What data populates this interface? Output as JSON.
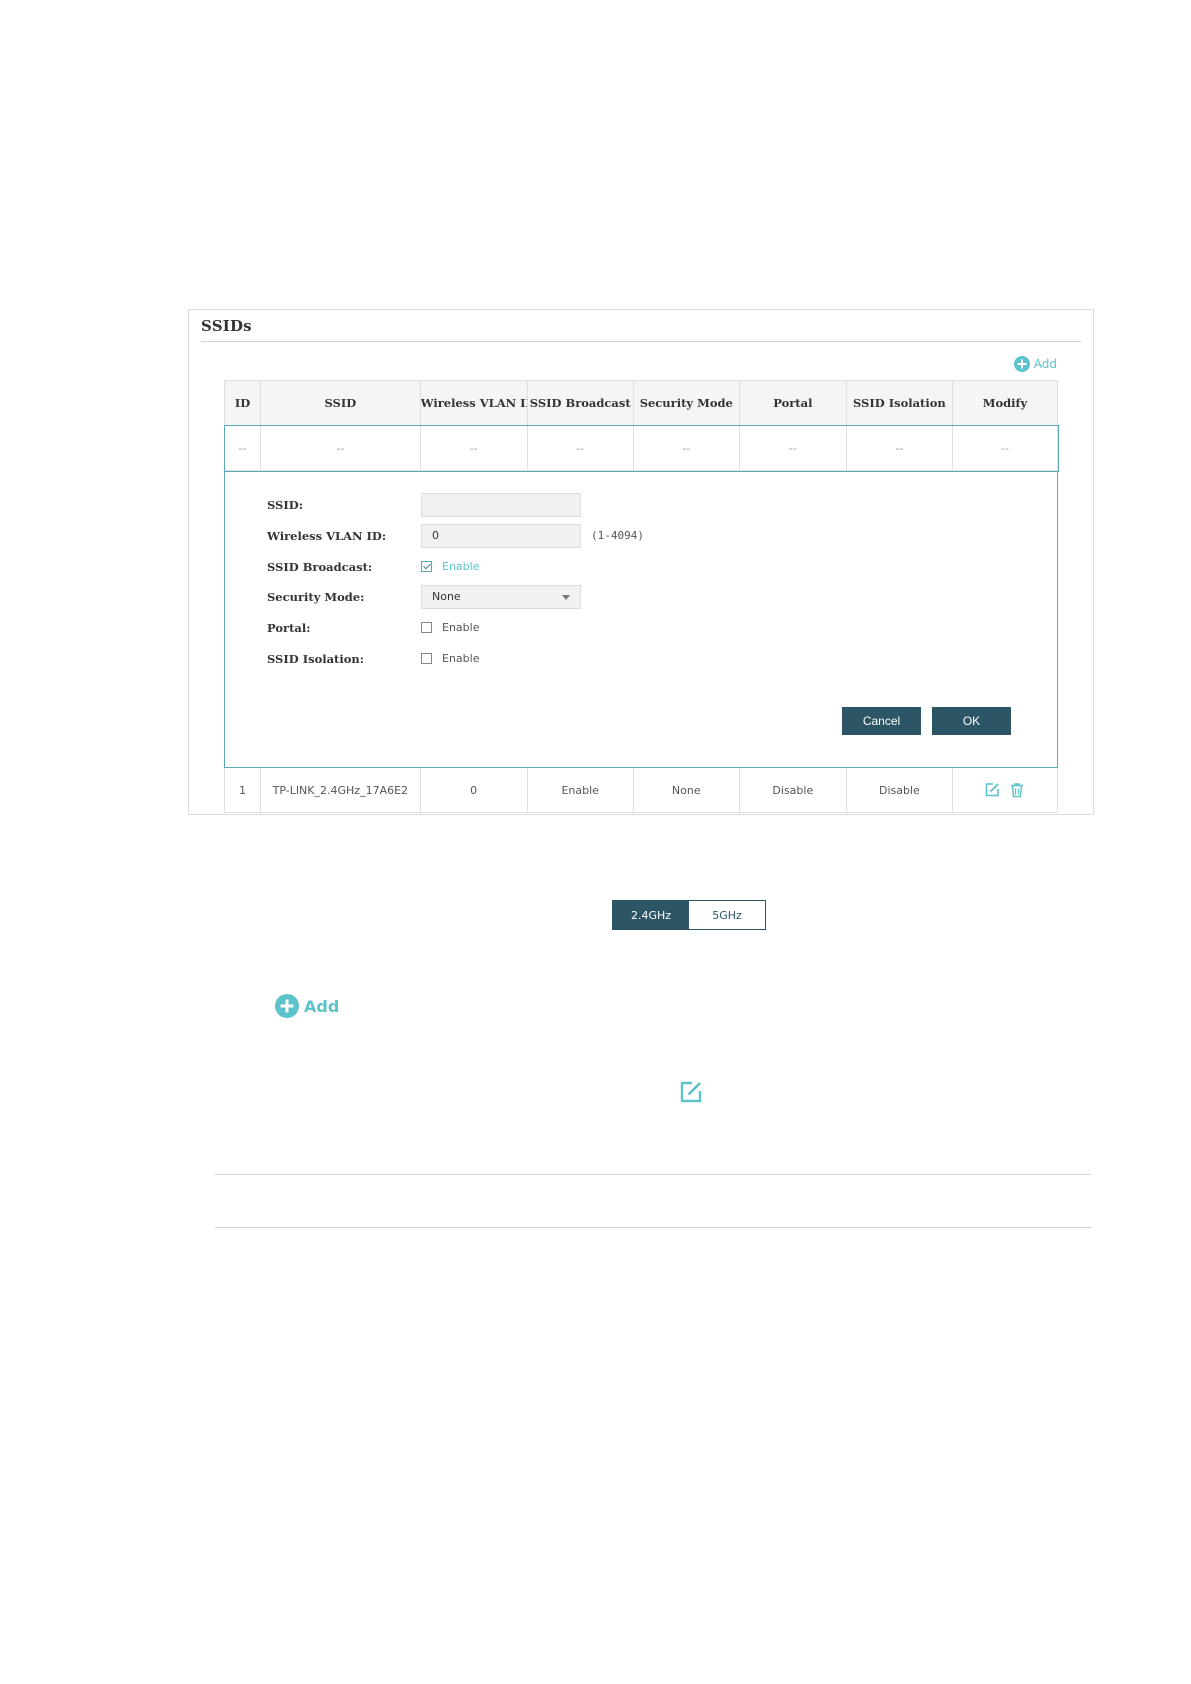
{
  "panel": {
    "title": "SSIDs",
    "add_label": "Add",
    "columns": [
      "ID",
      "SSID",
      "Wireless VLAN ID",
      "SSID Broadcast",
      "Security Mode",
      "Portal",
      "SSID Isolation",
      "Modify"
    ],
    "placeholder_row": [
      "--",
      "--",
      "--",
      "--",
      "--",
      "--",
      "--",
      "--"
    ],
    "form": {
      "ssid_label": "SSID:",
      "ssid_value": "",
      "vlan_label": "Wireless VLAN ID:",
      "vlan_value": "0",
      "vlan_hint": "(1-4094)",
      "broadcast_label": "SSID Broadcast:",
      "broadcast_option": "Enable",
      "security_label": "Security Mode:",
      "security_value": "None",
      "portal_label": "Portal:",
      "portal_option": "Enable",
      "isolation_label": "SSID Isolation:",
      "isolation_option": "Enable",
      "cancel_label": "Cancel",
      "ok_label": "OK"
    },
    "rows": [
      {
        "id": "1",
        "ssid": "TP-LINK_2.4GHz_17A6E2",
        "vlan": "0",
        "broadcast": "Enable",
        "security": "None",
        "portal": "Disable",
        "isolation": "Disable"
      }
    ]
  },
  "band": {
    "option_1": "2.4GHz",
    "option_2": "5GHz"
  },
  "add_button": {
    "label": "Add"
  },
  "colors": {
    "accent": "#5bc3c9",
    "button": "#2c5566",
    "border": "#5aaab5"
  }
}
